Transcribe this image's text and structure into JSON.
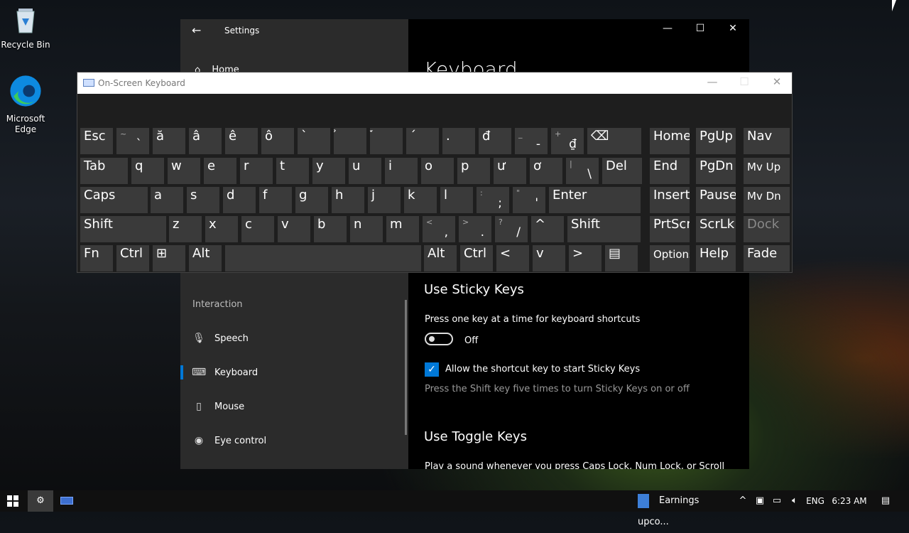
{
  "desktop": {
    "icons": [
      {
        "label": "Recycle Bin"
      },
      {
        "label": "Microsoft Edge"
      }
    ]
  },
  "settings": {
    "title": "Settings",
    "home_label": "Home",
    "page_title": "Keyboard",
    "section_label": "Interaction",
    "nav_items": [
      {
        "label": "Speech",
        "icon": "microphone-icon"
      },
      {
        "label": "Keyboard",
        "icon": "keyboard-icon",
        "selected": true
      },
      {
        "label": "Mouse",
        "icon": "mouse-icon"
      },
      {
        "label": "Eye control",
        "icon": "eye-icon"
      }
    ],
    "sticky": {
      "heading": "Use Sticky Keys",
      "description": "Press one key at a time for keyboard shortcuts",
      "toggle_state": "Off",
      "checkbox_label": "Allow the shortcut key to start Sticky Keys",
      "checkbox_checked": true,
      "hint": "Press the Shift key five times to turn Sticky Keys on or off"
    },
    "toggle_keys": {
      "heading": "Use Toggle Keys",
      "description": "Play a sound whenever you press Caps Lock, Num Lock, or Scroll"
    }
  },
  "osk": {
    "title": "On-Screen Keyboard",
    "rows": [
      [
        {
          "main": "Esc"
        },
        {
          "sub": "~",
          "main": "`"
        },
        {
          "main": "ă"
        },
        {
          "main": "â"
        },
        {
          "main": "ê"
        },
        {
          "main": "ô"
        },
        {
          "main": "`"
        },
        {
          "main": "̉"
        },
        {
          "main": "̃"
        },
        {
          "main": "´"
        },
        {
          "main": "."
        },
        {
          "main": "đ"
        },
        {
          "sub": "_",
          "main": "-"
        },
        {
          "sub": "+",
          "main": "₫"
        },
        {
          "main": "⌫"
        },
        {
          "main": "Home"
        },
        {
          "main": "PgUp"
        },
        {
          "main": "Nav"
        }
      ],
      [
        {
          "main": "Tab"
        },
        {
          "main": "q"
        },
        {
          "main": "w"
        },
        {
          "main": "e"
        },
        {
          "main": "r"
        },
        {
          "main": "t"
        },
        {
          "main": "y"
        },
        {
          "main": "u"
        },
        {
          "main": "i"
        },
        {
          "main": "o"
        },
        {
          "main": "p"
        },
        {
          "main": "ư"
        },
        {
          "main": "ơ"
        },
        {
          "sub": "|",
          "main": "\\"
        },
        {
          "main": "Del"
        },
        {
          "main": "End"
        },
        {
          "main": "PgDn"
        },
        {
          "main": "Mv Up"
        }
      ],
      [
        {
          "main": "Caps"
        },
        {
          "main": "a"
        },
        {
          "main": "s"
        },
        {
          "main": "d"
        },
        {
          "main": "f"
        },
        {
          "main": "g"
        },
        {
          "main": "h"
        },
        {
          "main": "j"
        },
        {
          "main": "k"
        },
        {
          "main": "l"
        },
        {
          "sub": ":",
          "main": ";"
        },
        {
          "sub": "\"",
          "main": "'"
        },
        {
          "main": "Enter"
        },
        {
          "main": "Insert"
        },
        {
          "main": "Pause"
        },
        {
          "main": "Mv Dn"
        }
      ],
      [
        {
          "main": "Shift"
        },
        {
          "main": "z"
        },
        {
          "main": "x"
        },
        {
          "main": "c"
        },
        {
          "main": "v"
        },
        {
          "main": "b"
        },
        {
          "main": "n"
        },
        {
          "main": "m"
        },
        {
          "sub": "<",
          "main": ","
        },
        {
          "sub": ">",
          "main": "."
        },
        {
          "sub": "?",
          "main": "/"
        },
        {
          "main": "^"
        },
        {
          "main": "Shift"
        },
        {
          "main": "PrtScn"
        },
        {
          "main": "ScrLk"
        },
        {
          "main": "Dock",
          "disabled": true
        }
      ],
      [
        {
          "main": "Fn"
        },
        {
          "main": "Ctrl"
        },
        {
          "main": "⊞"
        },
        {
          "main": "Alt"
        },
        {
          "main": ""
        },
        {
          "main": "Alt"
        },
        {
          "main": "Ctrl"
        },
        {
          "main": "<"
        },
        {
          "main": "v"
        },
        {
          "main": ">"
        },
        {
          "main": "▤"
        },
        {
          "main": "Options"
        },
        {
          "main": "Help"
        },
        {
          "main": "Fade"
        }
      ]
    ]
  },
  "taskbar": {
    "notification_title": "Earnings upco...",
    "language": "ENG",
    "time": "6:23 AM"
  }
}
